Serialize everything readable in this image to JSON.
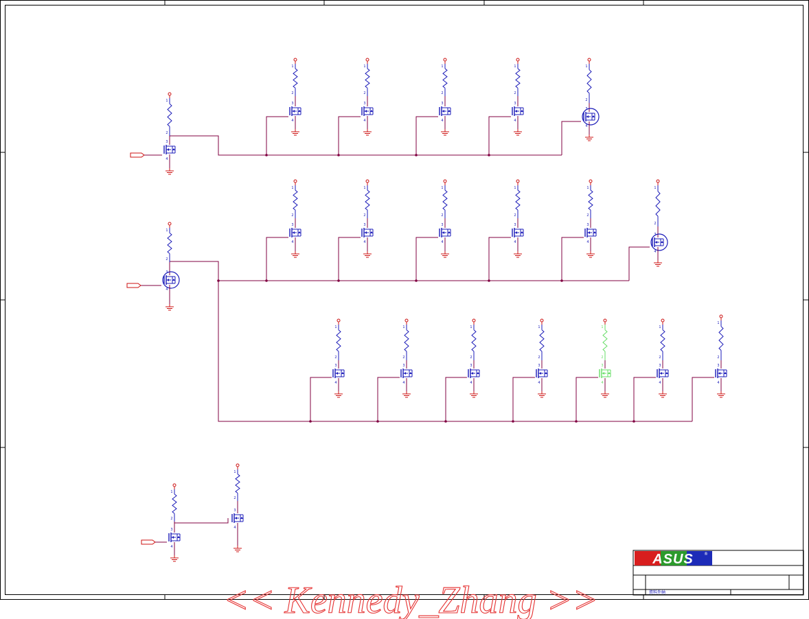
{
  "titleblock": {
    "logo_text": "ASUS",
    "footer_text": "資料外納"
  },
  "watermark": "<< Kennedy_Zhang >>",
  "pin_labels": [
    "1",
    "2",
    "3",
    "4",
    "5",
    "6"
  ],
  "colors": {
    "wire": "#800040",
    "symbol": "#1a1ab8",
    "power": "#cc1111",
    "highlight": "#66dd66",
    "border": "#000000",
    "watermark": "#e53030"
  },
  "icons": {
    "resistor": "resistor-icon",
    "mosfet": "mosfet-icon",
    "ground": "ground-icon",
    "vcc": "vcc-icon",
    "offpage": "offpage-connector-icon",
    "logo": "asus-logo"
  }
}
